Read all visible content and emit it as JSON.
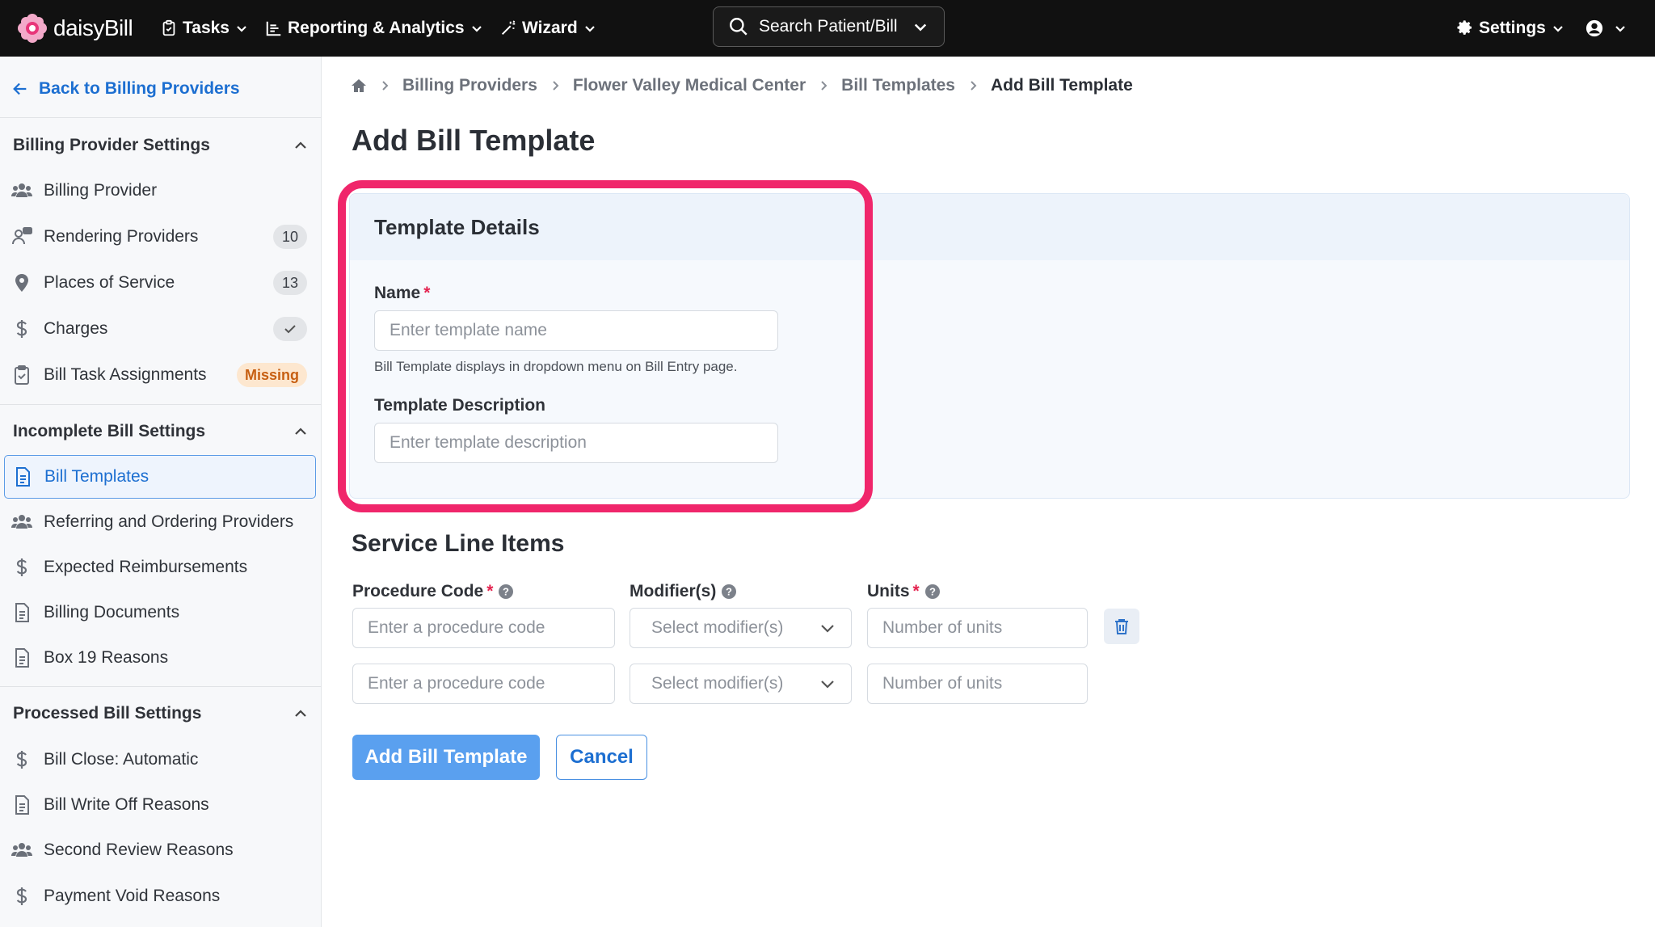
{
  "app": {
    "logo_text": "daisyBill",
    "brand_color": "#f0266b"
  },
  "topnav": {
    "items": [
      {
        "label": "Tasks",
        "icon": "clipboard-check-icon"
      },
      {
        "label": "Reporting & Analytics",
        "icon": "bar-chart-icon"
      },
      {
        "label": "Wizard",
        "icon": "magic-wand-icon"
      }
    ],
    "search": {
      "label": "Search Patient/Bill",
      "icon": "search-icon"
    },
    "settings_label": "Settings",
    "account_icon": "user-circle-icon"
  },
  "sidebar": {
    "back_label": "Back to Billing Providers",
    "sections": [
      {
        "title": "Billing Provider Settings",
        "items": [
          {
            "label": "Billing Provider",
            "icon": "users-icon"
          },
          {
            "label": "Rendering Providers",
            "icon": "user-chat-icon",
            "badge": "10"
          },
          {
            "label": "Places of Service",
            "icon": "map-pin-icon",
            "badge": "13"
          },
          {
            "label": "Charges",
            "icon": "dollar-icon",
            "badge_icon": "check-icon"
          },
          {
            "label": "Bill Task Assignments",
            "icon": "clipboard-check-icon",
            "badge": "Missing"
          }
        ]
      },
      {
        "title": "Incomplete Bill Settings",
        "items": [
          {
            "label": "Bill Templates",
            "icon": "document-icon",
            "active": true
          },
          {
            "label": "Referring and Ordering Providers",
            "icon": "users-icon"
          },
          {
            "label": "Expected Reimbursements",
            "icon": "dollar-icon"
          },
          {
            "label": "Billing Documents",
            "icon": "document-icon"
          },
          {
            "label": "Box 19 Reasons",
            "icon": "document-icon"
          }
        ]
      },
      {
        "title": "Processed Bill Settings",
        "items": [
          {
            "label": "Bill Close: Automatic",
            "icon": "dollar-icon"
          },
          {
            "label": "Bill Write Off Reasons",
            "icon": "document-icon"
          },
          {
            "label": "Second Review Reasons",
            "icon": "users-icon"
          },
          {
            "label": "Payment Void Reasons",
            "icon": "dollar-icon"
          }
        ]
      }
    ]
  },
  "breadcrumb": [
    "Billing Providers",
    "Flower Valley Medical Center",
    "Bill Templates",
    "Add Bill Template"
  ],
  "page_title": "Add Bill Template",
  "template_details": {
    "title": "Template Details",
    "name_label": "Name",
    "name_required": "*",
    "name_placeholder": "Enter template name",
    "name_help": "Bill Template displays in dropdown menu on Bill Entry page.",
    "description_label": "Template Description",
    "description_placeholder": "Enter template description"
  },
  "service_line_items": {
    "title": "Service Line Items",
    "columns": {
      "procedure_code": "Procedure Code",
      "modifiers": "Modifier(s)",
      "units": "Units",
      "required": "*"
    },
    "rows": [
      {
        "procedure_placeholder": "Enter a procedure code",
        "modifier_placeholder": "Select modifier(s)",
        "units_placeholder": "Number of units"
      },
      {
        "procedure_placeholder": "Enter a procedure code",
        "modifier_placeholder": "Select modifier(s)",
        "units_placeholder": "Number of units"
      }
    ]
  },
  "actions": {
    "submit_label": "Add Bill Template",
    "cancel_label": "Cancel"
  }
}
